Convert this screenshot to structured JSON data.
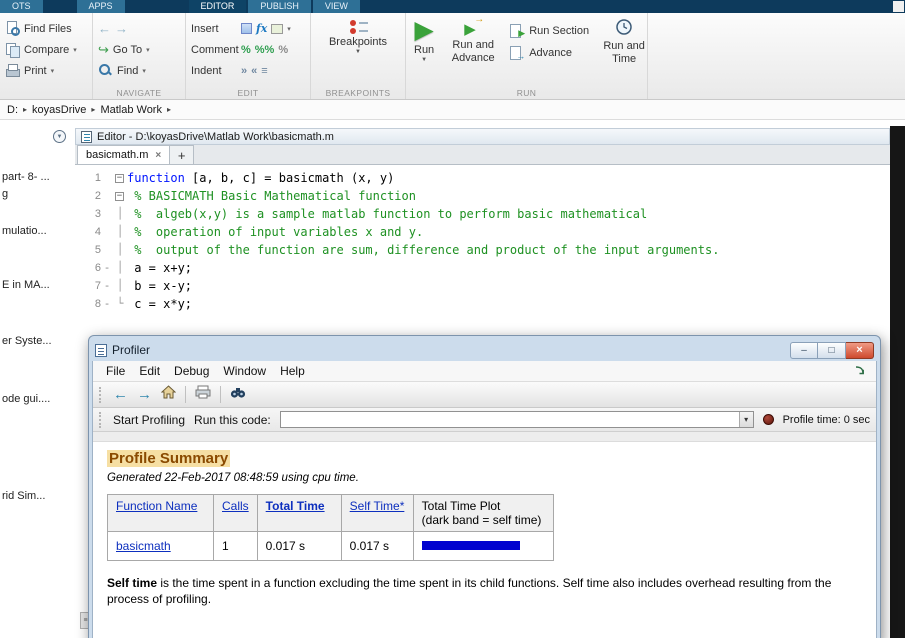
{
  "icons": {
    "caret_down": "▾",
    "caret_down_filled": "▼",
    "crumb_sep": "▸",
    "back_arrow": "←",
    "forward_arrow": "→",
    "run_play": "▶",
    "goto_arrow": "↪",
    "advance_arrow": "→",
    "close": "×",
    "minimize": "–",
    "restore": "□",
    "plus": "+",
    "percent": "%",
    "double_percent": "%%",
    "fx": "fx",
    "indent_right": "»",
    "indent_left": "«",
    "indent_lines": "≡",
    "splitter": "≡",
    "panel_menu": "▼"
  },
  "ribbon": {
    "tabs": [
      {
        "label": "OTS",
        "active": false
      },
      {
        "label": "APPS",
        "active": false
      },
      {
        "label": "EDITOR",
        "active": true
      },
      {
        "label": "PUBLISH",
        "active": false
      },
      {
        "label": "VIEW",
        "active": false
      }
    ],
    "file_group": {
      "find_files": "Find Files",
      "compare": "Compare",
      "print": "Print"
    },
    "navigate_group": {
      "label": "NAVIGATE",
      "goto": "Go To",
      "find": "Find"
    },
    "edit_group": {
      "label": "EDIT",
      "insert": "Insert",
      "comment": "Comment",
      "indent": "Indent"
    },
    "breakpoints_group": {
      "label": "BREAKPOINTS",
      "button": "Breakpoints"
    },
    "run_group": {
      "label": "RUN",
      "run": "Run",
      "run_and_advance": "Run and Advance",
      "run_section": "Run Section",
      "advance": "Advance",
      "run_and_time": "Run and Time"
    }
  },
  "breadcrumb": {
    "parts": [
      "D:",
      "koyasDrive",
      "Matlab Work"
    ]
  },
  "sidebar": {
    "items": [
      "part- 8- ...",
      "g",
      "mulatio...",
      "E in MA...",
      "er Syste...",
      "ode gui....",
      "rid Sim..."
    ]
  },
  "editor": {
    "title": "Editor - D:\\koyasDrive\\Matlab Work\\basicmath.m",
    "tab": "basicmath.m",
    "lines": [
      {
        "num": "1",
        "exec": false,
        "fold": "open",
        "parts": [
          {
            "t": "function",
            "c": "kw"
          },
          {
            "t": " [a, b, c] = basicmath (x, y)",
            "c": "txt"
          }
        ]
      },
      {
        "num": "2",
        "exec": false,
        "fold": "open",
        "parts": [
          {
            "t": " % BASICMATH Basic Mathematical function",
            "c": "cm"
          }
        ]
      },
      {
        "num": "3",
        "exec": false,
        "fold": "line",
        "parts": [
          {
            "t": " %  algeb(x,y) is a sample matlab function to perform basic mathematical",
            "c": "cm"
          }
        ]
      },
      {
        "num": "4",
        "exec": false,
        "fold": "line",
        "parts": [
          {
            "t": " %  operation of input variables x and y.",
            "c": "cm"
          }
        ]
      },
      {
        "num": "5",
        "exec": false,
        "fold": "line",
        "parts": [
          {
            "t": " %  output of the function are sum, difference and product of the input arguments.",
            "c": "cm"
          }
        ]
      },
      {
        "num": "6",
        "exec": true,
        "fold": "line",
        "parts": [
          {
            "t": " a = x+y;",
            "c": "txt"
          }
        ]
      },
      {
        "num": "7",
        "exec": true,
        "fold": "line",
        "parts": [
          {
            "t": " b = x-y;",
            "c": "txt"
          }
        ]
      },
      {
        "num": "8",
        "exec": true,
        "fold": "end",
        "parts": [
          {
            "t": " c = x*y;",
            "c": "txt"
          }
        ]
      }
    ]
  },
  "profiler": {
    "title": "Profiler",
    "menus": [
      "File",
      "Edit",
      "Debug",
      "Window",
      "Help"
    ],
    "run_bar": {
      "start_label": "Start Profiling",
      "run_label": "Run this code:",
      "time_label": "Profile time: 0 sec"
    },
    "summary": {
      "title": "Profile Summary",
      "generated": "Generated 22-Feb-2017 08:48:59 using cpu time.",
      "table": {
        "headers": [
          "Function Name",
          "Calls",
          "Total Time",
          "Self Time*",
          "Total Time Plot"
        ],
        "plot_subtitle": "(dark band = self time)",
        "rows": [
          {
            "function": "basicmath",
            "calls": "1",
            "total_time": "0.017 s",
            "self_time": "0.017 s",
            "bar_fraction": 0.8
          }
        ]
      },
      "footnote_lead": "Self time",
      "footnote_rest": " is the time spent in a function excluding the time spent in its child functions. Self time also includes overhead resulting from the process of profiling."
    }
  }
}
